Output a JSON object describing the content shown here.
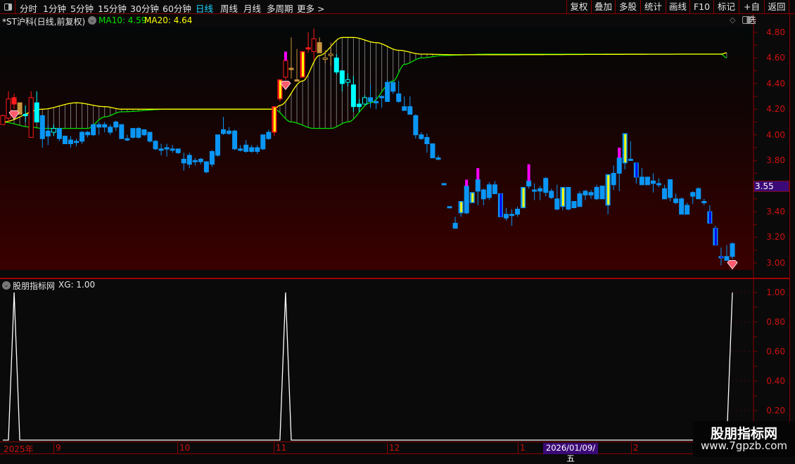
{
  "toolbar": {
    "periods": [
      "分时",
      "1分钟",
      "5分钟",
      "15分钟",
      "30分钟",
      "60分钟",
      "日线",
      "周线",
      "月线",
      "多周期",
      "更多 >"
    ],
    "active_period": "日线",
    "buttons": [
      "复权",
      "叠加",
      "多股",
      "统计",
      "画线",
      "F10",
      "标记",
      "+自选",
      "返回"
    ]
  },
  "main_panel": {
    "stock_title": "*ST沪科(日线,前复权)",
    "ma10_label": "MA10: 4.59",
    "ma20_label": "MA20: 4.64",
    "price_axis": [
      "4.80",
      "4.60",
      "4.40",
      "4.20",
      "4.00",
      "3.80",
      "3.40",
      "3.20",
      "3.00"
    ],
    "current_price_marker": "3.55",
    "colors": {
      "ma10": "#00e000",
      "ma20": "#ffff00",
      "down": "#0a96f5",
      "up": "#ff2020",
      "cyan": "#00ffff",
      "magenta": "#ff00ff",
      "background_bottom": "#3a0000"
    }
  },
  "indicator_panel": {
    "name": "股朋指标网",
    "value_label": "XG: 1.00",
    "axis": [
      "1.00",
      "0.80",
      "0.60",
      "0.40",
      "0.20"
    ],
    "xg_signal_indices": [
      2,
      50,
      129
    ]
  },
  "date_axis": {
    "labels": [
      "2025年",
      "9",
      "10",
      "11",
      "12",
      "1",
      "2"
    ],
    "highlight": "2026/01/09/五"
  },
  "watermark": {
    "name": "股朋指标网",
    "url": "www.7gpzb.com"
  },
  "kline": [
    [
      4.08,
      4.16,
      4.08,
      4.15,
      "r"
    ],
    [
      4.13,
      4.34,
      4.1,
      4.28,
      "r"
    ],
    [
      4.29,
      4.32,
      4.2,
      4.24,
      "rf"
    ],
    [
      4.25,
      4.25,
      4.16,
      4.16,
      "o"
    ],
    [
      4.16,
      4.23,
      4.1,
      4.16,
      "c"
    ],
    [
      3.98,
      4.34,
      3.98,
      4.29,
      "r"
    ],
    [
      4.25,
      4.34,
      4.1,
      4.1,
      "c"
    ],
    [
      4.15,
      4.15,
      3.9,
      3.97,
      "b"
    ],
    [
      4.03,
      4.08,
      3.92,
      3.99,
      "b"
    ],
    [
      4.02,
      4.08,
      3.99,
      4.05,
      "ch"
    ],
    [
      4.05,
      4.05,
      3.95,
      3.97,
      "b"
    ],
    [
      3.99,
      3.99,
      3.93,
      3.93,
      "b"
    ],
    [
      3.96,
      3.99,
      3.9,
      3.93,
      "b"
    ],
    [
      3.95,
      3.97,
      3.91,
      3.94,
      "b"
    ],
    [
      3.95,
      4.03,
      3.93,
      4.02,
      "b"
    ],
    [
      4.02,
      4.03,
      3.98,
      4.0,
      "b"
    ],
    [
      4.0,
      4.08,
      3.99,
      4.08,
      "b"
    ],
    [
      4.08,
      4.1,
      4.0,
      4.06,
      "b"
    ],
    [
      4.08,
      4.1,
      4.02,
      4.06,
      "b"
    ],
    [
      4.06,
      4.08,
      4.0,
      4.02,
      "b"
    ],
    [
      4.06,
      4.11,
      4.03,
      4.1,
      "b"
    ],
    [
      4.08,
      4.08,
      3.97,
      3.97,
      "b"
    ],
    [
      3.97,
      4.0,
      3.95,
      3.96,
      "b"
    ],
    [
      3.98,
      4.05,
      3.97,
      4.05,
      "b"
    ],
    [
      4.05,
      4.06,
      3.97,
      3.98,
      "b"
    ],
    [
      4.04,
      4.04,
      3.99,
      4.0,
      "b"
    ],
    [
      4.02,
      4.02,
      3.94,
      3.95,
      "b"
    ],
    [
      3.95,
      3.96,
      3.88,
      3.89,
      "b"
    ],
    [
      3.89,
      3.93,
      3.84,
      3.89,
      "b"
    ],
    [
      3.9,
      3.93,
      3.83,
      3.89,
      "b"
    ],
    [
      3.89,
      3.92,
      3.86,
      3.89,
      "b"
    ],
    [
      3.89,
      3.89,
      3.85,
      3.86,
      "b"
    ],
    [
      3.81,
      3.86,
      3.72,
      3.78,
      "b"
    ],
    [
      3.84,
      3.86,
      3.74,
      3.77,
      "b"
    ],
    [
      3.8,
      3.82,
      3.76,
      3.8,
      "b"
    ],
    [
      3.81,
      3.82,
      3.77,
      3.79,
      "b"
    ],
    [
      3.79,
      3.79,
      3.7,
      3.71,
      "b"
    ],
    [
      3.77,
      3.88,
      3.75,
      3.87,
      "b"
    ],
    [
      3.84,
      4.0,
      3.83,
      4.0,
      "b"
    ],
    [
      4.04,
      4.14,
      4.0,
      4.01,
      "b"
    ],
    [
      4.03,
      4.06,
      4.0,
      4.01,
      "b"
    ],
    [
      4.03,
      4.04,
      3.88,
      3.89,
      "b"
    ],
    [
      3.89,
      3.92,
      3.87,
      3.89,
      "b"
    ],
    [
      3.92,
      3.96,
      3.86,
      3.87,
      "b"
    ],
    [
      3.9,
      3.92,
      3.86,
      3.87,
      "b"
    ],
    [
      3.87,
      3.92,
      3.85,
      3.9,
      "b"
    ],
    [
      3.89,
      4.0,
      3.88,
      4.0,
      "b"
    ],
    [
      3.97,
      4.04,
      3.96,
      4.02,
      "b"
    ],
    [
      4.02,
      4.22,
      3.99,
      4.22,
      "yr"
    ],
    [
      4.28,
      4.43,
      4.26,
      4.43,
      "yr"
    ],
    [
      4.45,
      4.58,
      4.43,
      4.58,
      "r",
      4.65
    ],
    [
      4.52,
      4.76,
      4.44,
      4.52,
      "o"
    ],
    [
      4.43,
      4.67,
      4.42,
      4.43,
      "o"
    ],
    [
      4.45,
      4.65,
      4.45,
      4.65,
      "yr"
    ],
    [
      4.68,
      4.8,
      4.64,
      4.67,
      "rf"
    ],
    [
      4.65,
      4.83,
      4.58,
      4.75,
      "r"
    ],
    [
      4.72,
      4.76,
      4.64,
      4.64,
      "o"
    ],
    [
      4.59,
      4.66,
      4.56,
      4.6,
      "oh"
    ],
    [
      4.62,
      4.72,
      4.54,
      4.63,
      "oh"
    ],
    [
      4.6,
      4.63,
      4.47,
      4.49,
      "c"
    ],
    [
      4.5,
      4.5,
      4.34,
      4.4,
      "c"
    ],
    [
      4.41,
      4.48,
      4.38,
      4.43,
      "ch"
    ],
    [
      4.39,
      4.46,
      4.18,
      4.22,
      "c"
    ],
    [
      4.24,
      4.28,
      4.18,
      4.22,
      "c"
    ],
    [
      4.24,
      4.31,
      4.24,
      4.29,
      "ch"
    ],
    [
      4.29,
      4.39,
      4.21,
      4.26,
      "b"
    ],
    [
      4.26,
      4.3,
      4.2,
      4.26,
      "b"
    ],
    [
      4.3,
      4.31,
      4.21,
      4.29,
      "b"
    ],
    [
      4.26,
      4.43,
      4.26,
      4.41,
      "b"
    ],
    [
      4.41,
      4.41,
      4.32,
      4.34,
      "b"
    ],
    [
      4.32,
      4.42,
      4.25,
      4.26,
      "b"
    ],
    [
      4.22,
      4.3,
      4.19,
      4.19,
      "b"
    ],
    [
      4.22,
      4.3,
      4.16,
      4.16,
      "b"
    ],
    [
      4.15,
      4.16,
      3.97,
      4.0,
      "b"
    ],
    [
      4.0,
      4.02,
      3.96,
      3.97,
      "b"
    ],
    [
      3.98,
      4.01,
      3.86,
      3.93,
      "b"
    ],
    [
      3.93,
      3.93,
      3.82,
      3.82,
      "b"
    ],
    [
      3.82,
      3.84,
      3.8,
      3.81,
      "b"
    ],
    [
      3.62,
      3.62,
      3.62,
      3.62,
      "b"
    ],
    [
      3.44,
      3.44,
      3.44,
      3.44,
      "b"
    ],
    [
      3.31,
      3.36,
      3.27,
      3.27,
      "b"
    ],
    [
      3.39,
      3.48,
      3.36,
      3.48,
      "y"
    ],
    [
      3.39,
      3.6,
      3.38,
      3.6,
      "b",
      3.65
    ],
    [
      3.47,
      3.55,
      3.47,
      3.55,
      "y"
    ],
    [
      3.56,
      3.65,
      3.45,
      3.65,
      "b",
      3.74
    ],
    [
      3.57,
      3.58,
      3.45,
      3.5,
      "b"
    ],
    [
      3.51,
      3.63,
      3.49,
      3.61,
      "b"
    ],
    [
      3.61,
      3.64,
      3.55,
      3.54,
      "b"
    ],
    [
      3.54,
      3.54,
      3.36,
      3.36,
      "bd"
    ],
    [
      3.38,
      3.43,
      3.33,
      3.35,
      "b"
    ],
    [
      3.38,
      3.42,
      3.29,
      3.38,
      "b"
    ],
    [
      3.38,
      3.44,
      3.36,
      3.42,
      "b"
    ],
    [
      3.43,
      3.59,
      3.43,
      3.59,
      "y"
    ],
    [
      3.6,
      3.64,
      3.58,
      3.64,
      "b",
      3.77
    ],
    [
      3.57,
      3.62,
      3.49,
      3.57,
      "b"
    ],
    [
      3.56,
      3.6,
      3.49,
      3.58,
      "b"
    ],
    [
      3.66,
      3.67,
      3.52,
      3.55,
      "b"
    ],
    [
      3.56,
      3.58,
      3.5,
      3.51,
      "b"
    ],
    [
      3.5,
      3.61,
      3.41,
      3.42,
      "b"
    ],
    [
      3.44,
      3.59,
      3.41,
      3.59,
      "y"
    ],
    [
      3.59,
      3.59,
      3.41,
      3.42,
      "b"
    ],
    [
      3.48,
      3.48,
      3.43,
      3.43,
      "b"
    ],
    [
      3.44,
      3.56,
      3.44,
      3.54,
      "b"
    ],
    [
      3.53,
      3.57,
      3.49,
      3.56,
      "b"
    ],
    [
      3.55,
      3.57,
      3.5,
      3.53,
      "b"
    ],
    [
      3.5,
      3.61,
      3.49,
      3.59,
      "b"
    ],
    [
      3.5,
      3.6,
      3.5,
      3.6,
      "b"
    ],
    [
      3.45,
      3.69,
      3.38,
      3.69,
      "y"
    ],
    [
      3.61,
      3.76,
      3.57,
      3.7,
      "b"
    ],
    [
      3.7,
      3.82,
      3.56,
      3.82,
      "b",
      3.9
    ],
    [
      3.78,
      4.01,
      3.73,
      4.01,
      "y"
    ],
    [
      3.81,
      3.95,
      3.81,
      3.81,
      "b"
    ],
    [
      3.78,
      3.78,
      3.62,
      3.67,
      "bd"
    ],
    [
      3.67,
      3.74,
      3.61,
      3.61,
      "b"
    ],
    [
      3.61,
      3.67,
      3.61,
      3.67,
      "b"
    ],
    [
      3.64,
      3.7,
      3.55,
      3.62,
      "b"
    ],
    [
      3.62,
      3.66,
      3.59,
      3.62,
      "b"
    ],
    [
      3.58,
      3.61,
      3.5,
      3.5,
      "b"
    ],
    [
      3.65,
      3.65,
      3.48,
      3.51,
      "b"
    ],
    [
      3.5,
      3.54,
      3.46,
      3.47,
      "b"
    ],
    [
      3.5,
      3.51,
      3.38,
      3.38,
      "b"
    ],
    [
      3.45,
      3.47,
      3.38,
      3.38,
      "b"
    ],
    [
      3.55,
      3.56,
      3.46,
      3.52,
      "b"
    ],
    [
      3.58,
      3.59,
      3.5,
      3.5,
      "b"
    ],
    [
      3.48,
      3.5,
      3.45,
      3.48,
      "b"
    ],
    [
      3.4,
      3.45,
      3.31,
      3.31,
      "bd"
    ],
    [
      3.27,
      3.29,
      3.14,
      3.14,
      "bd"
    ],
    [
      3.05,
      3.12,
      2.98,
      3.04,
      "bd"
    ],
    [
      3.05,
      3.14,
      3.02,
      3.02,
      "b"
    ],
    [
      3.05,
      3.16,
      3.03,
      3.15,
      "b"
    ]
  ],
  "ma20_curve": [
    [
      0,
      4.1
    ],
    [
      7,
      4.2
    ],
    [
      13,
      4.25
    ],
    [
      18,
      4.22
    ],
    [
      21,
      4.2
    ],
    [
      48,
      4.2
    ],
    [
      49,
      4.23
    ],
    [
      53,
      4.42
    ],
    [
      56,
      4.62
    ],
    [
      60,
      4.76
    ],
    [
      62,
      4.76
    ],
    [
      66,
      4.72
    ],
    [
      70,
      4.66
    ],
    [
      74,
      4.63
    ],
    [
      80,
      4.625
    ],
    [
      127,
      4.63
    ],
    [
      128,
      4.64
    ]
  ],
  "ma10_curve": [
    [
      0,
      4.1
    ],
    [
      5,
      4.06
    ],
    [
      7,
      4.05
    ],
    [
      15,
      4.05
    ],
    [
      18,
      4.14
    ],
    [
      21,
      4.18
    ],
    [
      29,
      4.2
    ],
    [
      48,
      4.2
    ],
    [
      51,
      4.1
    ],
    [
      55,
      4.05
    ],
    [
      58,
      4.05
    ],
    [
      61,
      4.1
    ],
    [
      65,
      4.25
    ],
    [
      69,
      4.42
    ],
    [
      71,
      4.55
    ],
    [
      74,
      4.6
    ],
    [
      78,
      4.62
    ],
    [
      86,
      4.63
    ],
    [
      127,
      4.63
    ],
    [
      128,
      4.6
    ]
  ]
}
